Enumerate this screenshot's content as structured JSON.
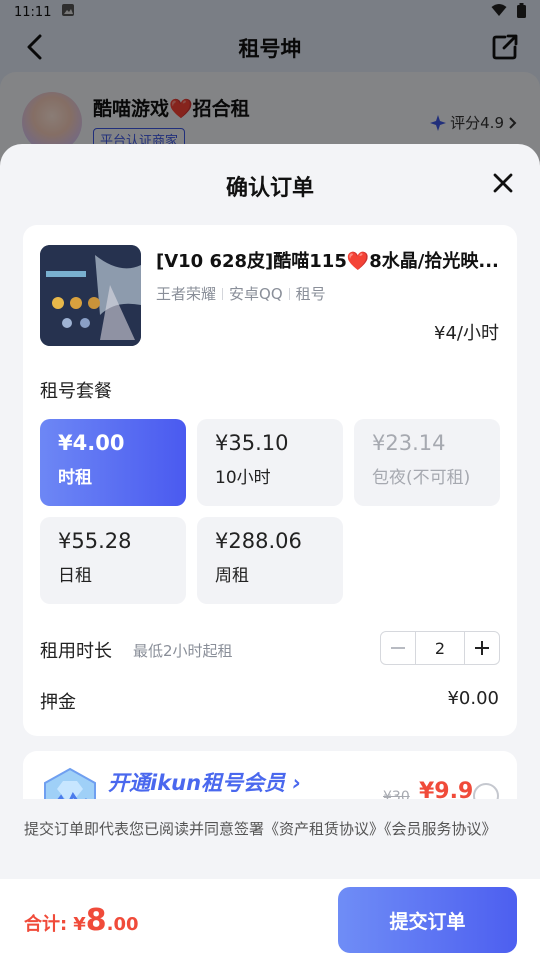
{
  "status_bar": {
    "time": "11:11"
  },
  "header": {
    "title": "租号坤"
  },
  "shop": {
    "name": "酷喵游戏❤️招合租",
    "badge": "平台认证商家",
    "rating": "评分4.9"
  },
  "sheet": {
    "title": "确认订单"
  },
  "product": {
    "title": "[V10 628皮]酷喵115❤️8水晶/拾光映...",
    "tags": [
      "王者荣耀",
      "安卓QQ",
      "租号"
    ],
    "unit_price": "¥4/小时"
  },
  "packages": {
    "label": "租号套餐",
    "options": [
      {
        "price": "¥4.00",
        "name": "时租",
        "state": "selected"
      },
      {
        "price": "¥35.10",
        "name": "10小时",
        "state": "normal"
      },
      {
        "price": "¥23.14",
        "name": "包夜(不可租)",
        "state": "disabled"
      },
      {
        "price": "¥55.28",
        "name": "日租",
        "state": "normal"
      },
      {
        "price": "¥288.06",
        "name": "周租",
        "state": "normal"
      }
    ]
  },
  "duration": {
    "label": "租用时长",
    "hint": "最低2小时起租",
    "value": "2"
  },
  "deposit": {
    "label": "押金",
    "value": "¥0.00"
  },
  "vip": {
    "text": "开通ikun租号会员 ›",
    "old_price": "¥30",
    "new_price": "¥9.9"
  },
  "agreement": {
    "text": "提交订单即代表您已阅读并同意签署《资产租赁协议》《会员服务协议》"
  },
  "footer": {
    "total_label": "合计:",
    "currency": "¥",
    "total_int": "8",
    "total_dec": ".00",
    "submit_label": "提交订单"
  },
  "colors": {
    "accent": "#4a5af0",
    "price_red": "#f04b3a"
  }
}
